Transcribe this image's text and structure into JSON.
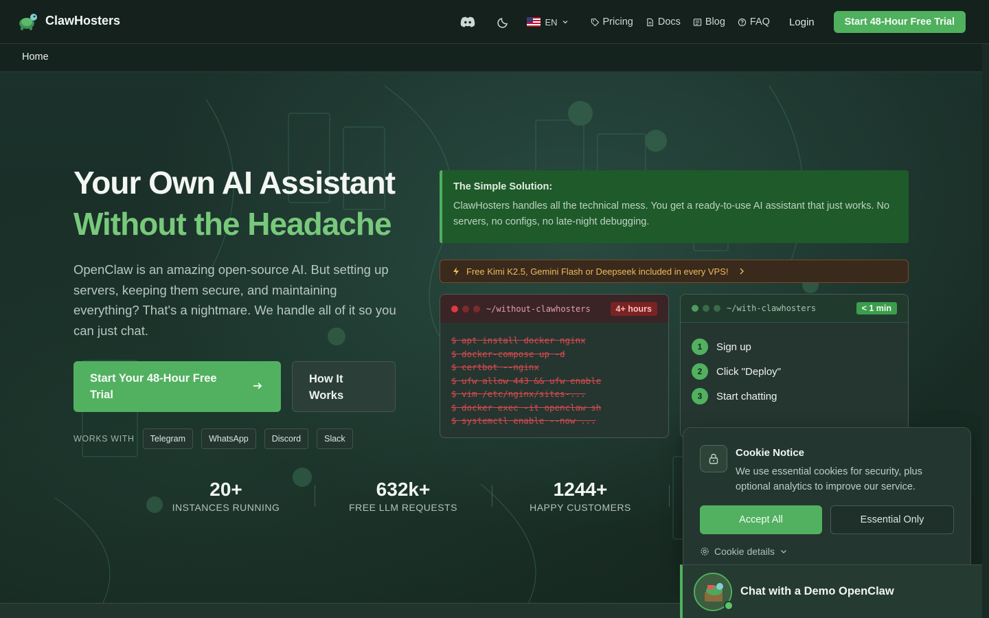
{
  "brand": {
    "name": "ClawHosters"
  },
  "nav": {
    "language": "EN",
    "links": [
      {
        "label": "Pricing",
        "icon": "tag-icon"
      },
      {
        "label": "Docs",
        "icon": "document-icon"
      },
      {
        "label": "Blog",
        "icon": "newspaper-icon"
      },
      {
        "label": "FAQ",
        "icon": "help-circle-icon"
      }
    ],
    "login": "Login",
    "cta": "Start 48-Hour Free Trial"
  },
  "breadcrumb": {
    "home": "Home"
  },
  "hero": {
    "title_line1": "Your Own AI Assistant",
    "title_line2": "Without the Headache",
    "description": "OpenClaw is an amazing open-source AI. But setting up servers, keeping them secure, and maintaining everything? That's a nightmare. We handle all of it so you can just chat.",
    "primary_cta": "Start Your 48-Hour Free Trial",
    "secondary_cta": "How It Works",
    "works_with_label": "WORKS WITH",
    "platforms": [
      "Telegram",
      "WhatsApp",
      "Discord",
      "Slack"
    ]
  },
  "stats": [
    {
      "value": "20+",
      "label": "INSTANCES RUNNING"
    },
    {
      "value": "632k+",
      "label": "FREE LLM REQUESTS"
    },
    {
      "value": "1244+",
      "label": "HAPPY CUSTOMERS"
    }
  ],
  "solution": {
    "title": "The Simple Solution:",
    "text": "ClawHosters handles all the technical mess. You get a ready-to-use AI assistant that just works. No servers, no configs, no late-night debugging."
  },
  "promo": {
    "text": "Free Kimi K2.5, Gemini Flash or Deepseek included in every VPS!"
  },
  "terminal_without": {
    "path": "~/without-clawhosters",
    "badge": "4+ hours",
    "commands": [
      "$ apt install docker nginx",
      "$ docker-compose up -d",
      "$ certbot --nginx",
      "$ ufw allow 443 && ufw enable",
      "$ vim /etc/nginx/sites-...",
      "$ docker exec -it openclaw sh",
      "$ systemctl enable --now ..."
    ]
  },
  "terminal_with": {
    "path": "~/with-clawhosters",
    "badge": "< 1 min",
    "steps": [
      {
        "num": "1",
        "label": "Sign up"
      },
      {
        "num": "2",
        "label": "Click \"Deploy\""
      },
      {
        "num": "3",
        "label": "Start chatting"
      }
    ]
  },
  "cookie": {
    "title": "Cookie Notice",
    "text": "We use essential cookies for security, plus optional analytics to improve our service.",
    "accept": "Accept All",
    "essential": "Essential Only",
    "details": "Cookie details"
  },
  "demo_chat": {
    "label": "Chat with a Demo OpenClaw"
  },
  "colors": {
    "accent": "#52b160",
    "headline_green": "#78c97b",
    "background": "#172a24",
    "danger": "#d84a4e",
    "promo": "#f1b95a"
  }
}
